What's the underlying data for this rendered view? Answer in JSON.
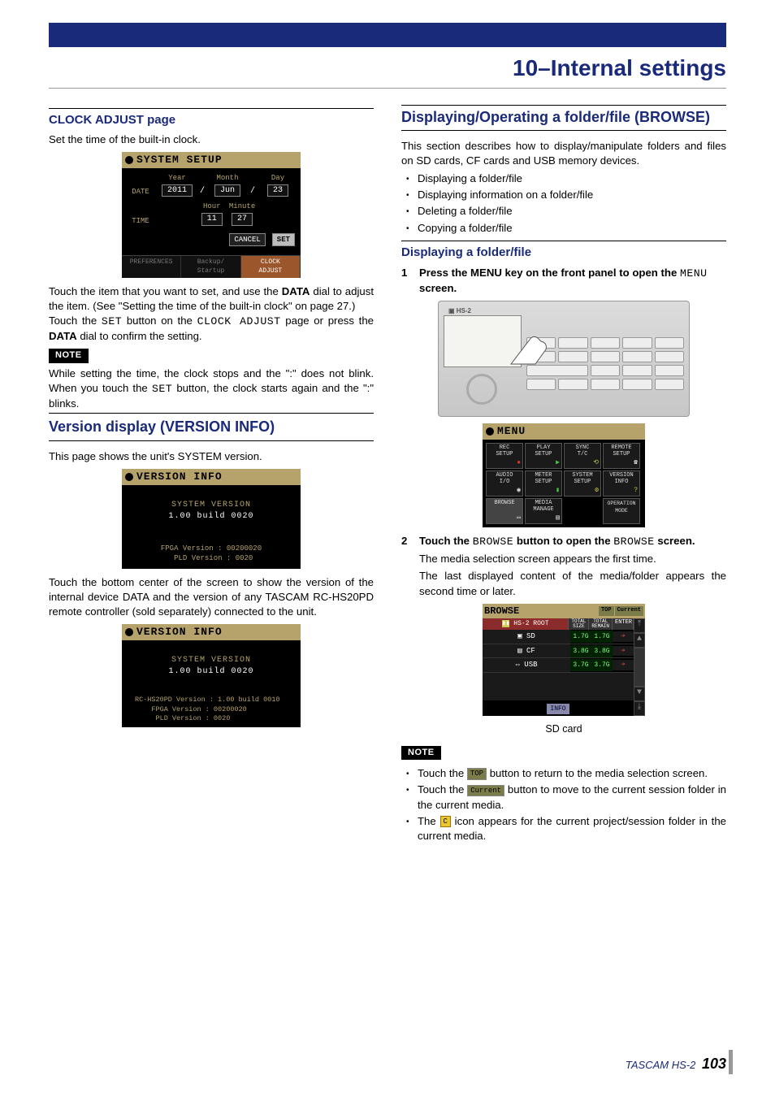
{
  "chapter_title": "10–Internal settings",
  "footer": {
    "brand": "TASCAM HS-2",
    "page": "103"
  },
  "left": {
    "h_clock": "CLOCK ADJUST page",
    "clock_intro": "Set the time of the built-in clock.",
    "system_setup": {
      "title": "SYSTEM SETUP",
      "date_lbl": "DATE",
      "time_lbl": "TIME",
      "year_lbl": "Year",
      "month_lbl": "Month",
      "day_lbl": "Day",
      "hour_lbl": "Hour",
      "minute_lbl": "Minute",
      "year": "2011",
      "month": "Jun",
      "day": "23",
      "hour": "11",
      "minute": "27",
      "cancel": "CANCEL",
      "set": "SET",
      "tab1": "PREFERENCES",
      "tab2": "Backup/\nStartup",
      "tab3": "CLOCK\nADJUST"
    },
    "clock_para1_a": "Touch the item that you want to set, and use the ",
    "clock_para1_b": "DATA",
    "clock_para1_c": " dial to adjust the item. (See \"Setting the time of the built-in clock\" on page 27.)",
    "clock_para2_a": "Touch the ",
    "clock_para2_b": "SET",
    "clock_para2_c": " button on the ",
    "clock_para2_d": "CLOCK ADJUST",
    "clock_para2_e": " page or press the ",
    "clock_para2_f": "DATA",
    "clock_para2_g": " dial to confirm the setting.",
    "note_label": "NOTE",
    "clock_note_a": "While setting the time, the clock stops and the \":\" does not blink. When you touch the ",
    "clock_note_b": "SET",
    "clock_note_c": " button, the clock starts again and the \":\" blinks.",
    "h_version": "Version display (VERSION INFO)",
    "version_intro": "This page shows the unit's SYSTEM version.",
    "version1": {
      "title": "VERSION INFO",
      "l1": "SYSTEM VERSION",
      "l2": "1.00 build 0020",
      "l3": "FPGA Version : 00200020",
      "l4": " PLD Version : 0020"
    },
    "version_para": "Touch the bottom center of the screen to show the version of the internal device DATA and the version of any TASCAM RC-HS20PD remote controller (sold separately) connected to the unit.",
    "version2": {
      "title": "VERSION INFO",
      "l1": "SYSTEM VERSION",
      "l2": "1.00 build 0020",
      "l3": "RC-HS20PD Version : 1.00 build 0010",
      "l4": "    FPGA Version : 00200020",
      "l5": "     PLD Version : 0020"
    }
  },
  "right": {
    "h_browse_major": "Displaying/Operating a folder/file (BROWSE)",
    "intro": "This section describes how to display/manipulate folders and files on SD cards, CF cards and USB memory devices.",
    "bullets1": [
      "Displaying a folder/file",
      "Displaying information on a folder/file",
      "Deleting a folder/file",
      "Copying a folder/file"
    ],
    "h_disp": "Displaying a folder/file",
    "step1_a": "Press the MENU key on the front panel to open the ",
    "step1_b": "MENU",
    "step1_c": " screen.",
    "device_label": "HS-2",
    "menu": {
      "title": "MENU",
      "cells": [
        "REC\nSETUP",
        "PLAY\nSETUP",
        "SYNC\nT/C",
        "REMOTE\nSETUP",
        "AUDIO\nI/O",
        "METER\nSETUP",
        "SYSTEM\nSETUP",
        "VERSION\nINFO",
        "BROWSE",
        "MEDIA\nMANAGE",
        "",
        "OPERATION\nMODE"
      ]
    },
    "step2_a": "Touch the ",
    "step2_b": "BROWSE",
    "step2_c": " button to open the ",
    "step2_d": "BROWSE",
    "step2_e": " screen.",
    "step2_sub1": "The media selection screen appears the first time.",
    "step2_sub2": "The last displayed content of the media/folder appears the second time or later.",
    "browse": {
      "title": "BROWSE",
      "top": "TOP",
      "current": "Current",
      "path": "HS-2 ROOT",
      "cols": [
        "TOTAL\nSIZE",
        "TOTAL\nREMAIN",
        "ENTER"
      ],
      "rows": [
        {
          "icon": "SD",
          "name": "SD",
          "s1": "1.7G",
          "s2": "1.7G"
        },
        {
          "icon": "CF",
          "name": "CF",
          "s1": "3.8G",
          "s2": "3.8G"
        },
        {
          "icon": "USB",
          "name": "USB",
          "s1": "3.7G",
          "s2": "3.7G"
        }
      ],
      "info": "INFO"
    },
    "caption_sd": "SD card",
    "note2_1_a": "Touch the ",
    "note2_1_b": " button to return to the media selection screen.",
    "note2_2_a": "Touch the ",
    "note2_2_b": " button to move to the current session folder in the current media.",
    "note2_3_a": "The ",
    "note2_3_b": " icon appears for the current project/session folder in the current media.",
    "icon_top": "TOP",
    "icon_current": "Current",
    "icon_c": "C"
  }
}
